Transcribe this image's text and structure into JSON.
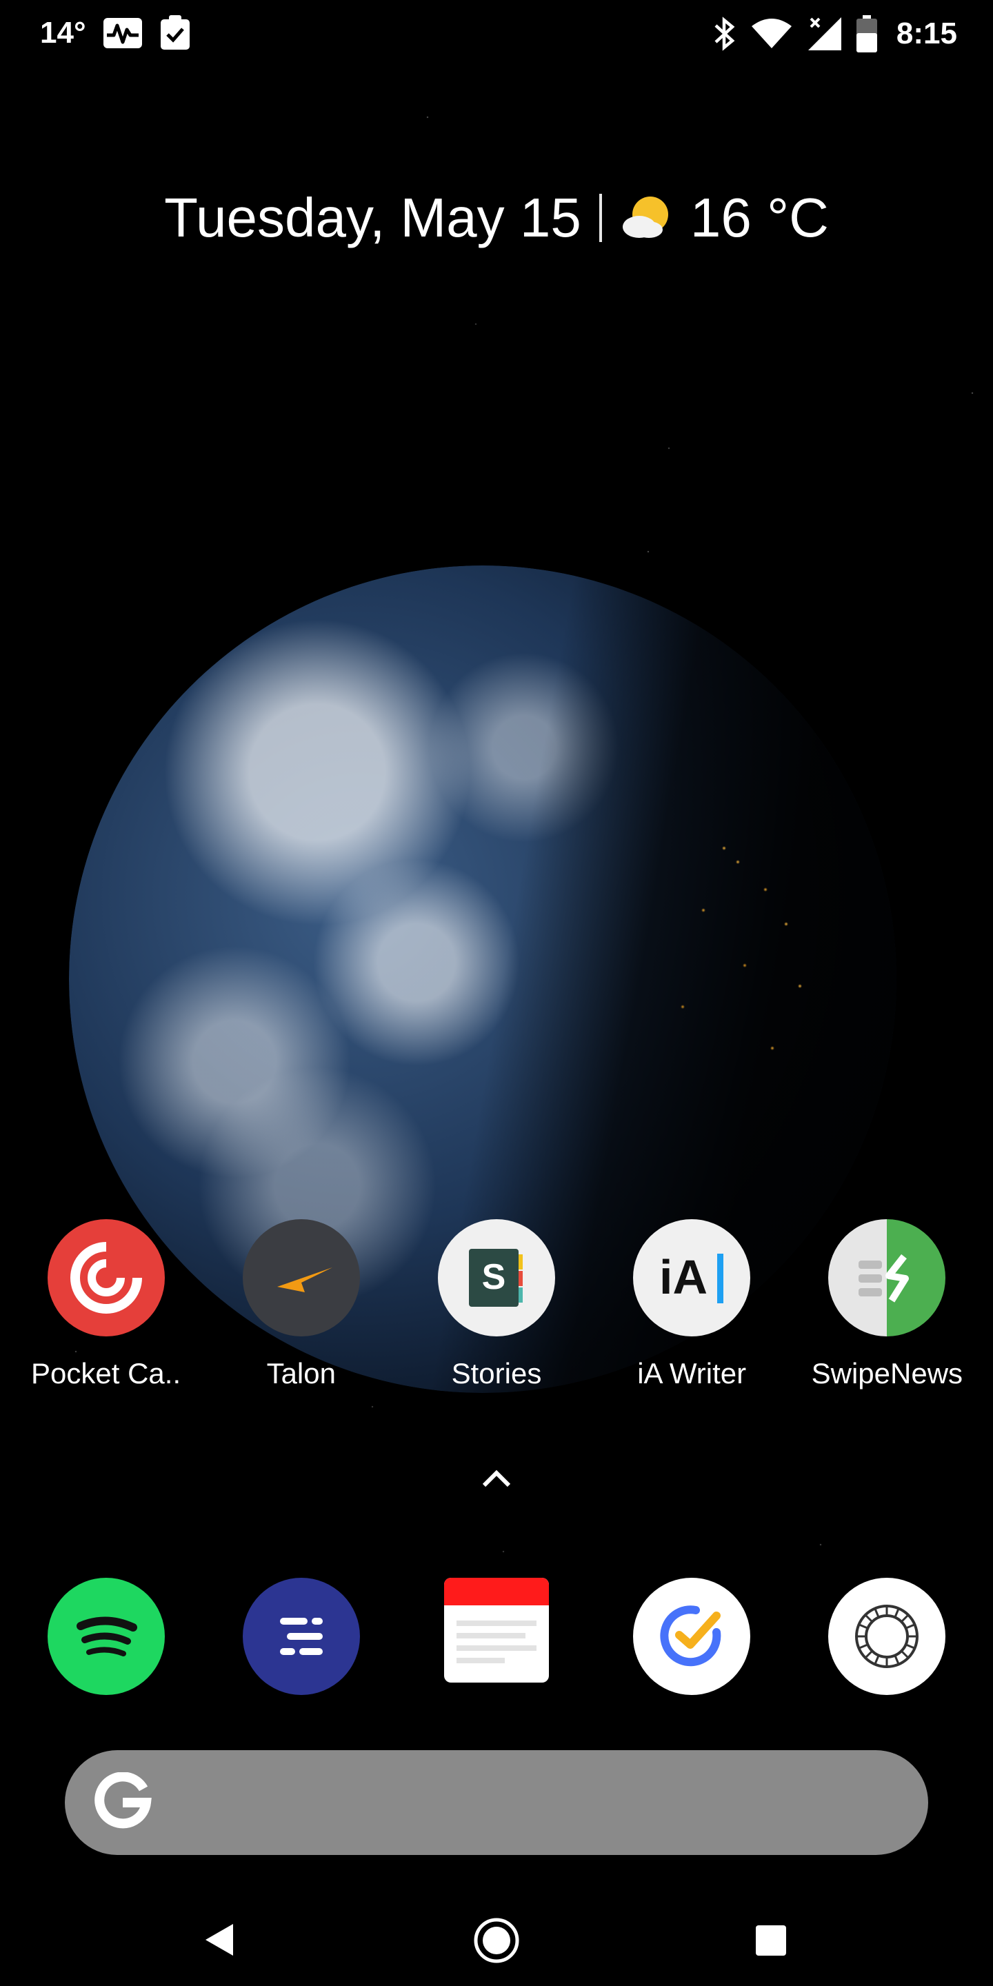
{
  "status_bar": {
    "temperature": "14°",
    "time": "8:15",
    "icons": [
      "heart-rate-icon",
      "clipboard-check-icon",
      "bluetooth-icon",
      "wifi-icon",
      "no-signal-icon",
      "battery-icon"
    ]
  },
  "glance": {
    "date": "Tuesday, May 15",
    "weather_icon": "partly-cloudy-icon",
    "weather": "16 °C"
  },
  "home_apps": [
    {
      "label": "Pocket Ca..",
      "icon": "pocket-casts-icon",
      "color": "#e53f3a"
    },
    {
      "label": "Talon",
      "icon": "talon-icon",
      "color": "#3b3d42"
    },
    {
      "label": "Stories",
      "icon": "stories-icon",
      "color": "#f0f0f0"
    },
    {
      "label": "iA Writer",
      "icon": "ia-writer-icon",
      "color": "#f0f0f0"
    },
    {
      "label": "SwipeNews",
      "icon": "swipenews-icon",
      "color": "#4caf50"
    }
  ],
  "app_drawer_icon": "chevron-up-icon",
  "dock": [
    {
      "icon": "spotify-icon",
      "color": "#1ed760"
    },
    {
      "icon": "notes-app-icon",
      "color": "#2c3592"
    },
    {
      "icon": "calendar-app-icon",
      "color": "#ff1b1b"
    },
    {
      "icon": "ticktick-icon",
      "color": "#4772fa"
    },
    {
      "icon": "aperture-icon",
      "color": "#ffffff"
    }
  ],
  "search": {
    "logo": "google-g-icon"
  },
  "navigation": [
    "back-icon",
    "home-icon",
    "recents-icon"
  ]
}
